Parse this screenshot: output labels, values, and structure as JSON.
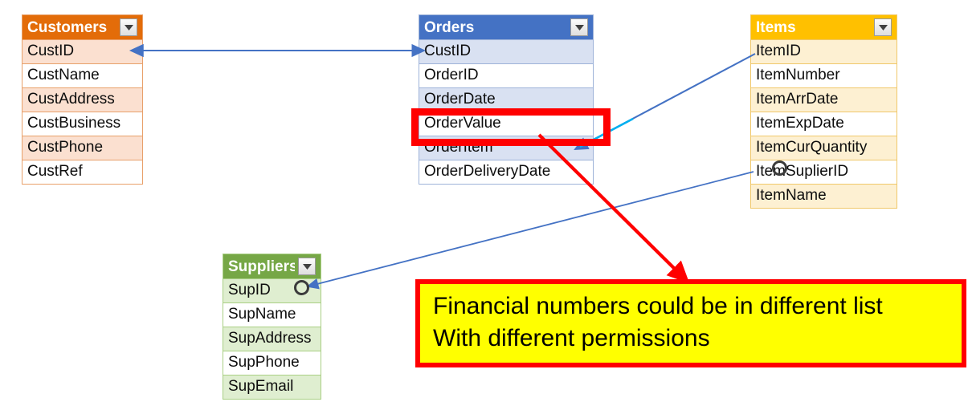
{
  "diagram": {
    "tables": [
      {
        "name": "Customers",
        "title": "Customers",
        "filter_icon": "chevron-down-icon",
        "header_color": "#E36C09",
        "band_color": "#FBE0D0",
        "rows": [
          "CustID",
          "CustName",
          "CustAddress",
          "CustBusiness",
          "CustPhone",
          "CustRef"
        ]
      },
      {
        "name": "Orders",
        "title": "Orders",
        "filter_icon": "chevron-down-icon",
        "header_color": "#4472C4",
        "band_color": "#D9E1F2",
        "rows": [
          "CustID",
          "OrderID",
          "OrderDate",
          "OrderValue",
          "OrderItem",
          "OrderDeliveryDate"
        ]
      },
      {
        "name": "Items",
        "title": "Items",
        "filter_icon": "chevron-down-icon",
        "header_color": "#FFC000",
        "band_color": "#FDF0D2",
        "rows": [
          "ItemID",
          "ItemNumber",
          "ItemArrDate",
          "ItemExpDate",
          "ItemCurQuantity",
          "ItemSuplierID",
          "ItemName"
        ]
      },
      {
        "name": "Suppliers",
        "title": "Suppliers",
        "filter_icon": "chevron-down-icon",
        "header_color": "#76A746",
        "band_color": "#DFEED0",
        "rows": [
          "SupID",
          "SupName",
          "SupAddress",
          "SupPhone",
          "SupEmail"
        ]
      }
    ],
    "callout": {
      "line1": "Financial numbers could be in different list",
      "line2": "With different permissions",
      "background_color": "#FFFF00",
      "border_color": "#FF0000"
    },
    "highlight": {
      "target_field": "OrderValue",
      "border_color": "#FF0000"
    },
    "connectors": {
      "relationship_color": "#4472C4",
      "accent_color": "#00B0F0",
      "pointer_color": "#FF0000"
    }
  }
}
